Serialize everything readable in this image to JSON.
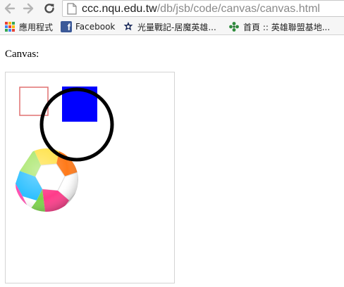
{
  "browser": {
    "url_host": "ccc.nqu.edu.tw",
    "url_path": "/db/jsb/code/canvas/canvas.html"
  },
  "bookmarks": [
    {
      "label": "應用程式",
      "icon": "apps-grid-icon"
    },
    {
      "label": "Facebook",
      "icon": "facebook-icon"
    },
    {
      "label": "光量戰記-居魔英雄...",
      "icon": "site-logo-icon"
    },
    {
      "label": "首頁 :: 英雄聯盟基地...",
      "icon": "league-icon"
    }
  ],
  "page": {
    "label": "Canvas:"
  },
  "colors": {
    "square_outline": "#e07070",
    "square_fill": "#0000ff",
    "circle_stroke": "#000000"
  }
}
